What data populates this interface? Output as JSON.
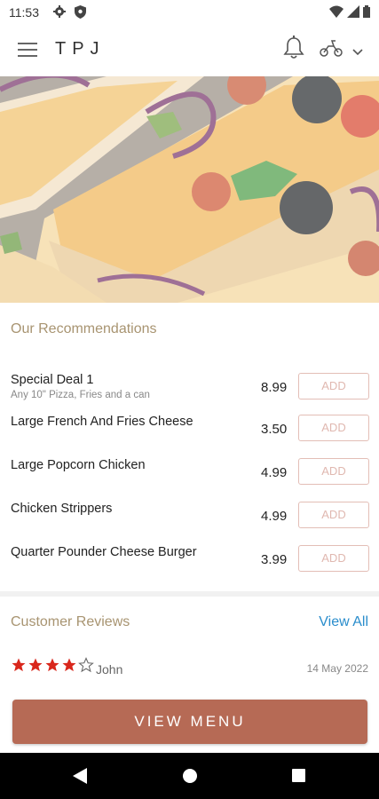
{
  "status_bar": {
    "time": "11:53"
  },
  "app_bar": {
    "brand": "TPJ"
  },
  "recommendations": {
    "title": "Our Recommendations",
    "add_label": "ADD",
    "items": [
      {
        "name": "Special Deal 1",
        "desc": "Any 10\" Pizza, Fries and a can",
        "price": "8.99"
      },
      {
        "name": "Large French And Fries Cheese",
        "price": "3.50"
      },
      {
        "name": "Large Popcorn Chicken",
        "price": "4.99"
      },
      {
        "name": "Chicken Strippers",
        "price": "4.99"
      },
      {
        "name": "Quarter Pounder Cheese Burger",
        "price": "3.99"
      }
    ]
  },
  "reviews": {
    "title": "Customer Reviews",
    "view_all": "View All",
    "items": [
      {
        "rating": 4,
        "max_rating": 5,
        "author": "John",
        "date": "14 May 2022"
      }
    ]
  },
  "footer": {
    "view_menu": "VIEW MENU"
  },
  "colors": {
    "accent": "#b66a55",
    "section_title": "#a89471",
    "link": "#2a8dcc",
    "star": "#d9271c"
  },
  "icons": [
    "settings-icon",
    "shield-icon",
    "wifi-icon",
    "signal-icon",
    "battery-icon",
    "menu-icon",
    "bell-icon",
    "scooter-icon",
    "chevron-down-icon",
    "back-icon",
    "home-icon",
    "recents-icon"
  ]
}
